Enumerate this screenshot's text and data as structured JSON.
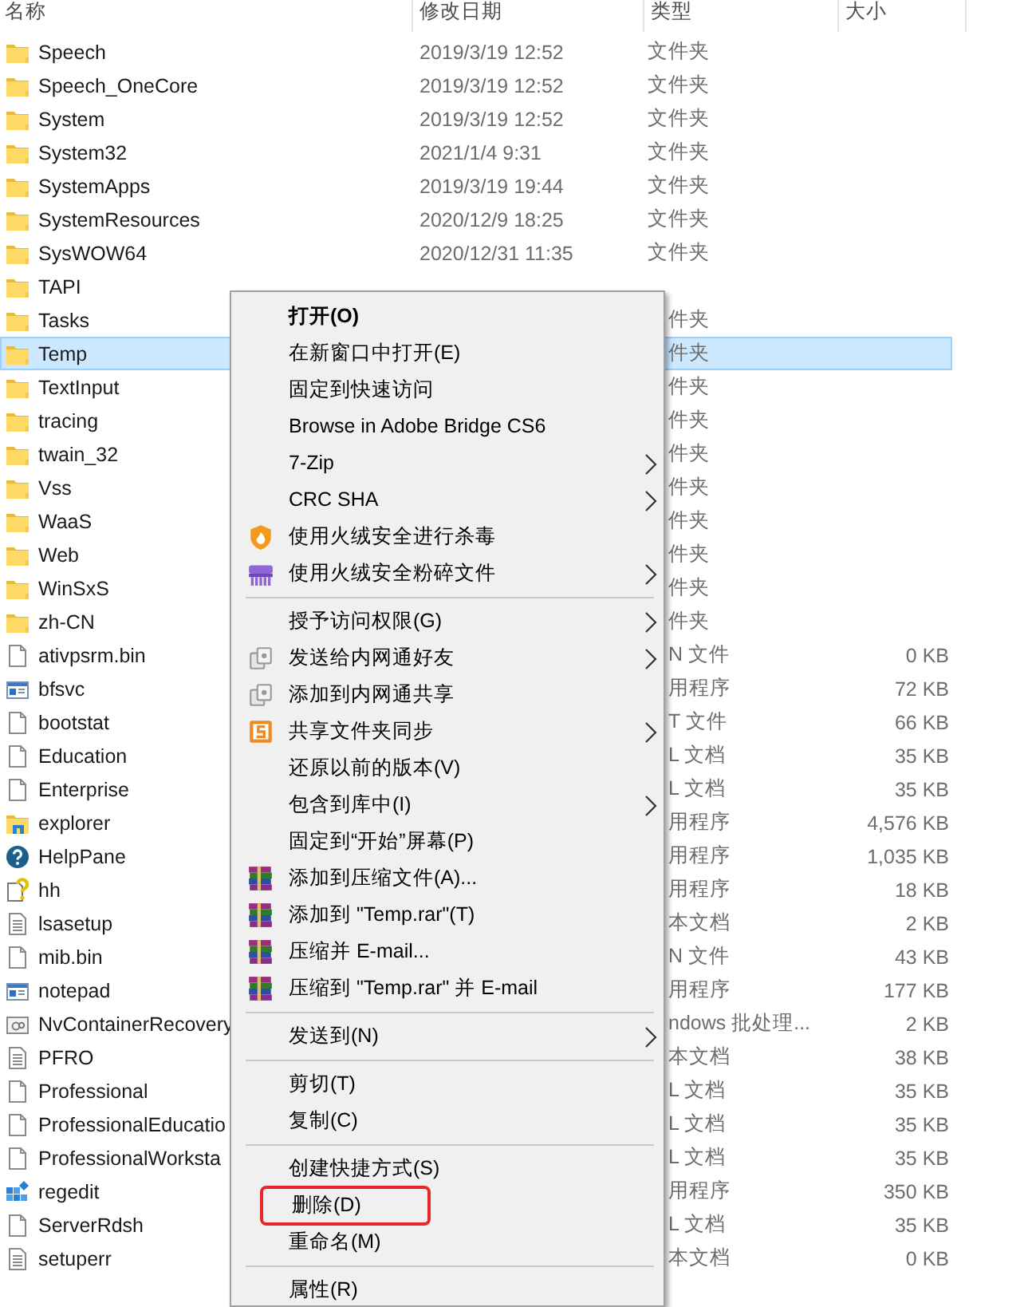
{
  "columns": [
    "名称",
    "修改日期",
    "类型",
    "大小"
  ],
  "rows": [
    {
      "name": "Speech",
      "kind": "folder",
      "date": "2019/3/19 12:52",
      "type": "文件夹",
      "selected": false
    },
    {
      "name": "Speech_OneCore",
      "kind": "folder",
      "date": "2019/3/19 12:52",
      "type": "文件夹",
      "selected": false
    },
    {
      "name": "System",
      "kind": "folder",
      "date": "2019/3/19 12:52",
      "type": "文件夹",
      "selected": false
    },
    {
      "name": "System32",
      "kind": "folder",
      "date": "2021/1/4 9:31",
      "type": "文件夹",
      "selected": false
    },
    {
      "name": "SystemApps",
      "kind": "folder",
      "date": "2019/3/19 19:44",
      "type": "文件夹",
      "selected": false
    },
    {
      "name": "SystemResources",
      "kind": "folder",
      "date": "2020/12/9 18:25",
      "type": "文件夹",
      "selected": false
    },
    {
      "name": "SysWOW64",
      "kind": "folder",
      "date": "2020/12/31 11:35",
      "type": "文件夹",
      "selected": false
    },
    {
      "name": "TAPI",
      "kind": "folder",
      "selected": false
    },
    {
      "name": "Tasks",
      "kind": "folder",
      "type_tail": "件夹",
      "selected": false
    },
    {
      "name": "Temp",
      "kind": "folder",
      "type_tail": "件夹",
      "selected": true
    },
    {
      "name": "TextInput",
      "kind": "folder",
      "type_tail": "件夹",
      "selected": false
    },
    {
      "name": "tracing",
      "kind": "folder",
      "type_tail": "件夹",
      "selected": false
    },
    {
      "name": "twain_32",
      "kind": "folder",
      "type_tail": "件夹",
      "selected": false
    },
    {
      "name": "Vss",
      "kind": "folder",
      "type_tail": "件夹",
      "selected": false
    },
    {
      "name": "WaaS",
      "kind": "folder",
      "type_tail": "件夹",
      "selected": false
    },
    {
      "name": "Web",
      "kind": "folder",
      "type_tail": "件夹",
      "selected": false
    },
    {
      "name": "WinSxS",
      "kind": "folder",
      "type_tail": "件夹",
      "selected": false
    },
    {
      "name": "zh-CN",
      "kind": "folder",
      "type_tail": "件夹",
      "selected": false
    },
    {
      "name": "ativpsrm.bin",
      "kind": "file",
      "type_tail": "N 文件",
      "size": "0 KB",
      "selected": false
    },
    {
      "name": "bfsvc",
      "kind": "app",
      "type_tail": "用程序",
      "size": "72 KB",
      "selected": false
    },
    {
      "name": "bootstat",
      "kind": "file",
      "type_tail": "T 文件",
      "size": "66 KB",
      "selected": false
    },
    {
      "name": "Education",
      "kind": "file",
      "type_tail": "L 文档",
      "size": "35 KB",
      "selected": false
    },
    {
      "name": "Enterprise",
      "kind": "file",
      "type_tail": "L 文档",
      "size": "35 KB",
      "selected": false
    },
    {
      "name": "explorer",
      "kind": "explorer",
      "type_tail": "用程序",
      "size": "4,576 KB",
      "selected": false
    },
    {
      "name": "HelpPane",
      "kind": "help",
      "type_tail": "用程序",
      "size": "1,035 KB",
      "selected": false
    },
    {
      "name": "hh",
      "kind": "helpdoc",
      "type_tail": "用程序",
      "size": "18 KB",
      "selected": false
    },
    {
      "name": "lsasetup",
      "kind": "text",
      "type_tail": "本文档",
      "size": "2 KB",
      "selected": false
    },
    {
      "name": "mib.bin",
      "kind": "file",
      "type_tail": "N 文件",
      "size": "43 KB",
      "selected": false
    },
    {
      "name": "notepad",
      "kind": "app",
      "type_tail": "用程序",
      "size": "177 KB",
      "selected": false
    },
    {
      "name": "NvContainerRecovery",
      "kind": "batch",
      "type_tail": "ndows 批处理...",
      "size": "2 KB",
      "selected": false
    },
    {
      "name": "PFRO",
      "kind": "text",
      "type_tail": "本文档",
      "size": "38 KB",
      "selected": false
    },
    {
      "name": "Professional",
      "kind": "file",
      "type_tail": "L 文档",
      "size": "35 KB",
      "selected": false
    },
    {
      "name": "ProfessionalEducatio",
      "kind": "file",
      "type_tail": "L 文档",
      "size": "35 KB",
      "selected": false
    },
    {
      "name": "ProfessionalWorksta",
      "kind": "file",
      "type_tail": "L 文档",
      "size": "35 KB",
      "selected": false
    },
    {
      "name": "regedit",
      "kind": "regedit",
      "type_tail": "用程序",
      "size": "350 KB",
      "selected": false
    },
    {
      "name": "ServerRdsh",
      "kind": "file",
      "type_tail": "L 文档",
      "size": "35 KB",
      "selected": false
    },
    {
      "name": "setuperr",
      "kind": "text",
      "type_tail": "本文档",
      "size": "0 KB",
      "selected": false
    }
  ],
  "context_menu": [
    {
      "kind": "item",
      "label": "打开(O)",
      "default": true,
      "submenu": false,
      "marked": false
    },
    {
      "kind": "item",
      "label": "在新窗口中打开(E)",
      "default": false,
      "submenu": false,
      "marked": false
    },
    {
      "kind": "item",
      "label": "固定到快速访问",
      "default": false,
      "submenu": false,
      "marked": false
    },
    {
      "kind": "item",
      "label": "Browse in Adobe Bridge CS6",
      "default": false,
      "submenu": false,
      "marked": false
    },
    {
      "kind": "item",
      "label": "7-Zip",
      "default": false,
      "submenu": true,
      "marked": false
    },
    {
      "kind": "item",
      "label": "CRC SHA",
      "default": false,
      "submenu": true,
      "marked": false
    },
    {
      "kind": "shield",
      "label": "使用火绒安全进行杀毒",
      "default": false,
      "submenu": false,
      "marked": false
    },
    {
      "kind": "shredder",
      "label": "使用火绒安全粉碎文件",
      "default": false,
      "submenu": true,
      "marked": false
    },
    {
      "kind": "separator"
    },
    {
      "kind": "item",
      "label": "授予访问权限(G)",
      "default": false,
      "submenu": true,
      "marked": false
    },
    {
      "kind": "share",
      "label": "发送给内网通好友",
      "default": false,
      "submenu": true,
      "marked": false
    },
    {
      "kind": "share",
      "label": "添加到内网通共享",
      "default": false,
      "submenu": false,
      "marked": false
    },
    {
      "kind": "sync",
      "label": "共享文件夹同步",
      "default": false,
      "submenu": true,
      "marked": false
    },
    {
      "kind": "item",
      "label": "还原以前的版本(V)",
      "default": false,
      "submenu": false,
      "marked": false
    },
    {
      "kind": "item",
      "label": "包含到库中(I)",
      "default": false,
      "submenu": true,
      "marked": false
    },
    {
      "kind": "item",
      "label": "固定到“开始”屏幕(P)",
      "default": false,
      "submenu": false,
      "marked": false
    },
    {
      "kind": "rar",
      "label": "添加到压缩文件(A)...",
      "default": false,
      "submenu": false,
      "marked": false
    },
    {
      "kind": "rar",
      "label": "添加到 \"Temp.rar\"(T)",
      "default": false,
      "submenu": false,
      "marked": false
    },
    {
      "kind": "rar",
      "label": "压缩并 E-mail...",
      "default": false,
      "submenu": false,
      "marked": false
    },
    {
      "kind": "rar",
      "label": "压缩到 \"Temp.rar\" 并 E-mail",
      "default": false,
      "submenu": false,
      "marked": false
    },
    {
      "kind": "separator"
    },
    {
      "kind": "item",
      "label": "发送到(N)",
      "default": false,
      "submenu": true,
      "marked": false
    },
    {
      "kind": "separator"
    },
    {
      "kind": "item",
      "label": "剪切(T)",
      "default": false,
      "submenu": false,
      "marked": false
    },
    {
      "kind": "item",
      "label": "复制(C)",
      "default": false,
      "submenu": false,
      "marked": false
    },
    {
      "kind": "separator"
    },
    {
      "kind": "item",
      "label": "创建快捷方式(S)",
      "default": false,
      "submenu": false,
      "marked": false
    },
    {
      "kind": "item",
      "label": "删除(D)",
      "default": false,
      "submenu": false,
      "marked": true
    },
    {
      "kind": "item",
      "label": "重命名(M)",
      "default": false,
      "submenu": false,
      "marked": false
    },
    {
      "kind": "separator"
    },
    {
      "kind": "item",
      "label": "属性(R)",
      "default": false,
      "submenu": false,
      "marked": false
    }
  ]
}
